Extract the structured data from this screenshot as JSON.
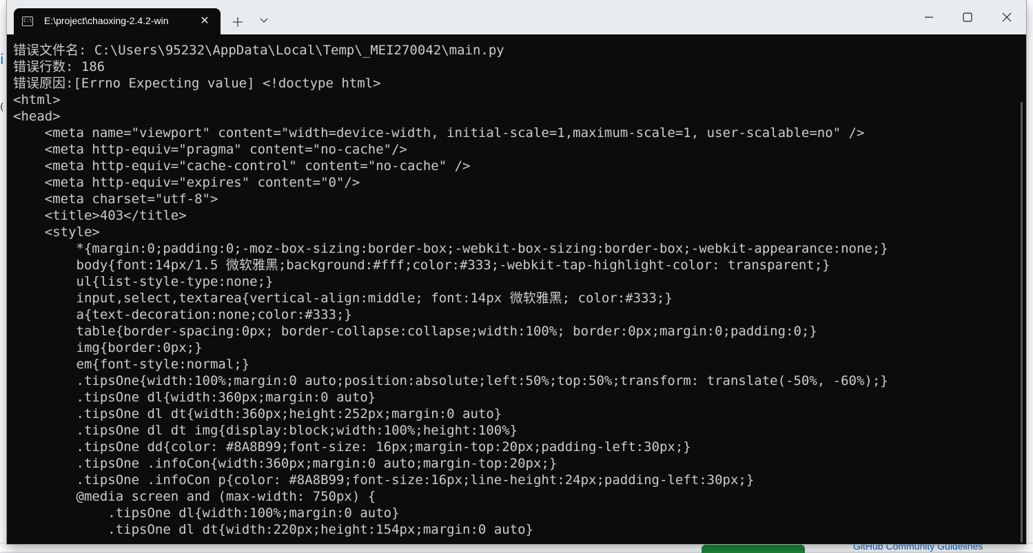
{
  "window": {
    "tab_title": "E:\\project\\chaoxing-2.4.2-win",
    "tab_icon_text": "C:\\"
  },
  "background": {
    "github_link": "GitHub Community Guidelines"
  },
  "colors": {
    "terminal_bg": "#0c0c0c",
    "terminal_fg": "#cccccc",
    "titlebar_bg": "#e9ecef"
  },
  "terminal": {
    "lines": [
      "错误文件名: C:\\Users\\95232\\AppData\\Local\\Temp\\_MEI270042\\main.py",
      "错误行数: 186",
      "错误原因:[Errno Expecting value] <!doctype html>",
      "<html>",
      "<head>",
      "    <meta name=\"viewport\" content=\"width=device-width, initial-scale=1,maximum-scale=1, user-scalable=no\" />",
      "    <meta http-equiv=\"pragma\" content=\"no-cache\"/>",
      "    <meta http-equiv=\"cache-control\" content=\"no-cache\" />",
      "    <meta http-equiv=\"expires\" content=\"0\"/>",
      "    <meta charset=\"utf-8\">",
      "    <title>403</title>",
      "    <style>",
      "        *{margin:0;padding:0;-moz-box-sizing:border-box;-webkit-box-sizing:border-box;-webkit-appearance:none;}",
      "        body{font:14px/1.5 微软雅黑;background:#fff;color:#333;-webkit-tap-highlight-color: transparent;}",
      "        ul{list-style-type:none;}",
      "        input,select,textarea{vertical-align:middle; font:14px 微软雅黑; color:#333;}",
      "        a{text-decoration:none;color:#333;}",
      "        table{border-spacing:0px; border-collapse:collapse;width:100%; border:0px;margin:0;padding:0;}",
      "        img{border:0px;}",
      "        em{font-style:normal;}",
      "        .tipsOne{width:100%;margin:0 auto;position:absolute;left:50%;top:50%;transform: translate(-50%, -60%);}",
      "        .tipsOne dl{width:360px;margin:0 auto}",
      "        .tipsOne dl dt{width:360px;height:252px;margin:0 auto}",
      "        .tipsOne dl dt img{display:block;width:100%;height:100%}",
      "        .tipsOne dd{color: #8A8B99;font-size: 16px;margin-top:20px;padding-left:30px;}",
      "        .tipsOne .infoCon{width:360px;margin:0 auto;margin-top:20px;}",
      "        .tipsOne .infoCon p{color: #8A8B99;font-size:16px;line-height:24px;padding-left:30px;}",
      "        @media screen and (max-width: 750px) {",
      "            .tipsOne dl{width:100%;margin:0 auto}",
      "            .tipsOne dl dt{width:220px;height:154px;margin:0 auto}"
    ]
  }
}
